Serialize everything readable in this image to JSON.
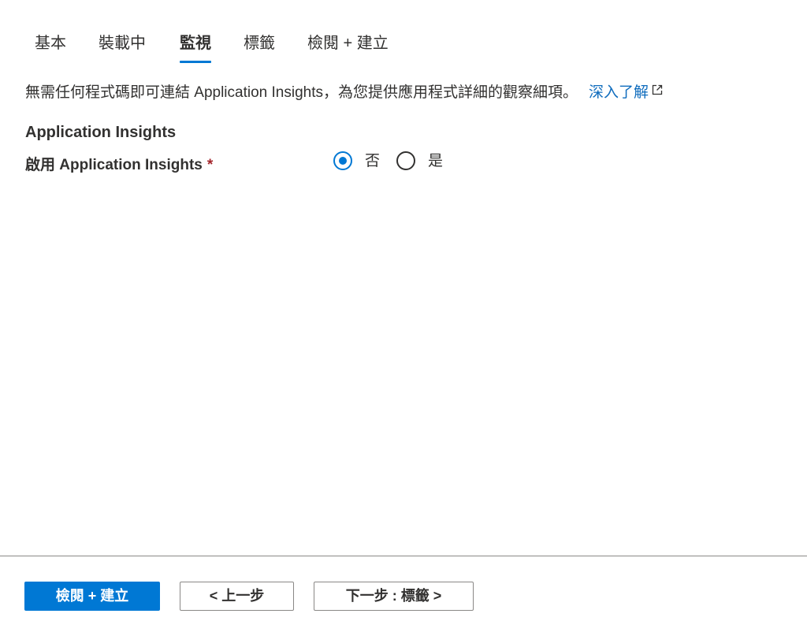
{
  "tabs": [
    {
      "label": "基本",
      "active": false
    },
    {
      "label": "裝載中",
      "active": false
    },
    {
      "label": "監視",
      "active": true
    },
    {
      "label": "標籤",
      "active": false
    },
    {
      "label": "檢閱 + 建立",
      "active": false
    }
  ],
  "description": {
    "text": "無需任何程式碼即可連結 Application Insights，為您提供應用程式詳細的觀察細項。",
    "link_label": "深入了解",
    "link_icon": "external-link-icon"
  },
  "section": {
    "title": "Application Insights",
    "field_label": "啟用 Application Insights",
    "required_marker": "*",
    "options": [
      {
        "label": "否",
        "checked": true
      },
      {
        "label": "是",
        "checked": false
      }
    ]
  },
  "footer": {
    "review_create_label": "檢閱 + 建立",
    "previous_label": "< 上一步",
    "next_label": "下一步 : 標籤 >"
  },
  "colors": {
    "accent": "#0078d4",
    "link": "#0f6cbd",
    "required": "#a4262c",
    "text": "#323130"
  }
}
